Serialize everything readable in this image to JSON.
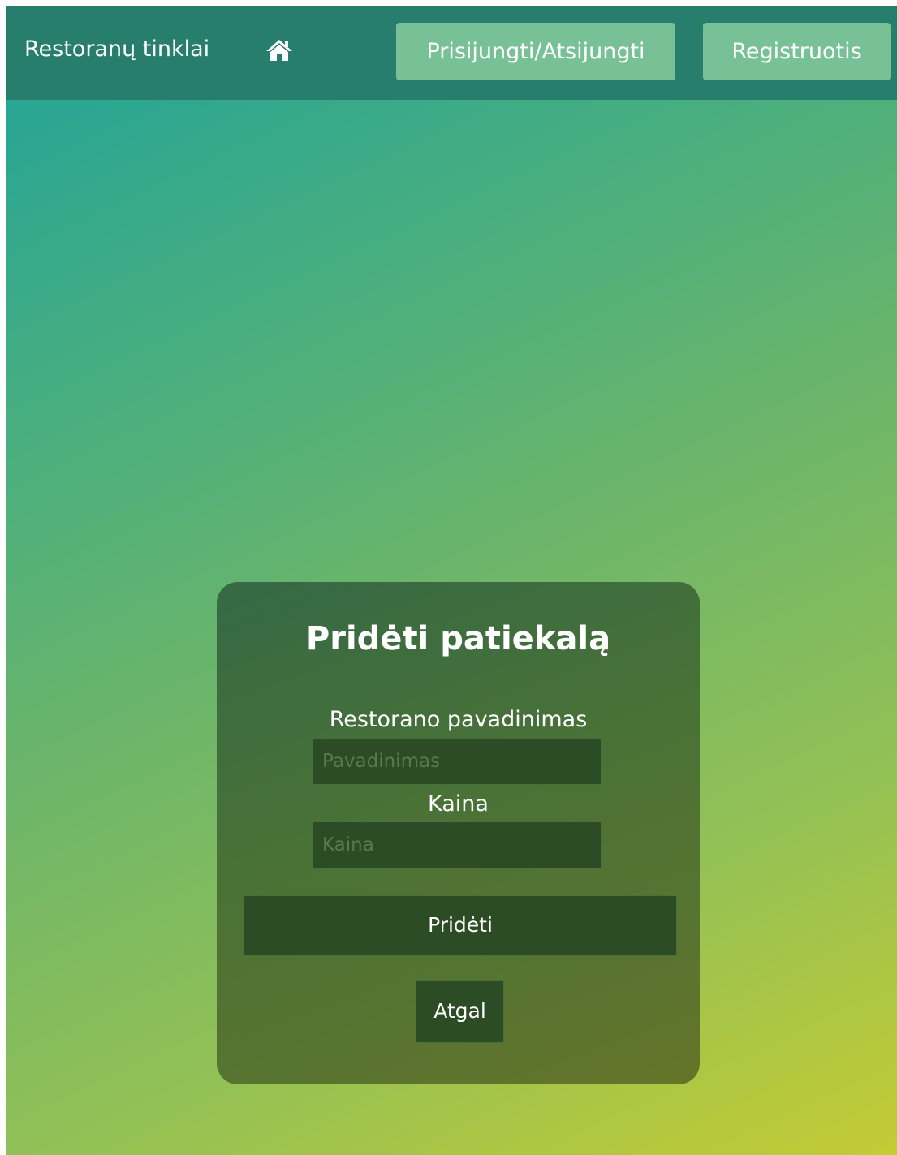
{
  "navbar": {
    "brand": "Restoranų tinklai",
    "home_icon": "home-icon",
    "login_label": "Prisijungti/Atsijungti",
    "register_label": "Registruotis"
  },
  "form": {
    "title": "Pridėti patiekalą",
    "name_label": "Restorano pavadinimas",
    "name_placeholder": "Pavadinimas",
    "name_value": "",
    "price_label": "Kaina",
    "price_placeholder": "Kaina",
    "price_value": "",
    "submit_label": "Pridėti",
    "back_label": "Atgal"
  },
  "colors": {
    "navbar": "#287e6c",
    "nav_button": "#78c197",
    "card_dark": "#2b4c25"
  }
}
